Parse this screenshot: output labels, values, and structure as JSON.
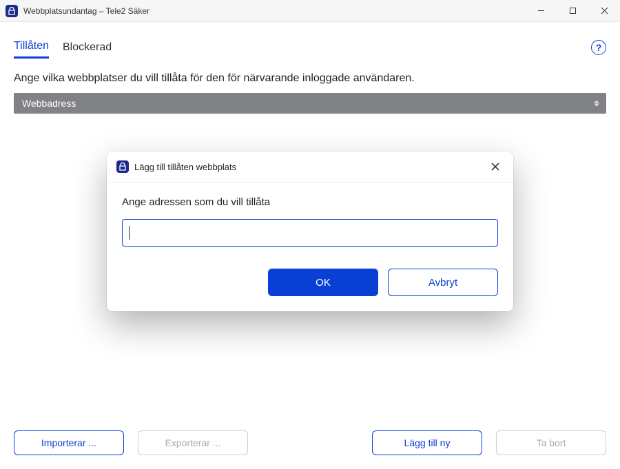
{
  "window": {
    "title": "Webbplatsundantag – Tele2 Säker"
  },
  "tabs": {
    "allowed": "Tillåten",
    "blocked": "Blockerad"
  },
  "help_glyph": "?",
  "instruction": "Ange vilka webbplatser du vill tillåta för den för närvarande inloggade användaren.",
  "column_header": "Webbadress",
  "buttons": {
    "import": "Importerar ...",
    "export": "Exporterar ...",
    "add_new": "Lägg till ny",
    "remove": "Ta bort"
  },
  "modal": {
    "title": "Lägg till tillåten webbplats",
    "prompt": "Ange adressen som du vill tillåta",
    "input_value": "",
    "ok": "OK",
    "cancel": "Avbryt"
  },
  "colors": {
    "accent": "#0a3fd6"
  }
}
